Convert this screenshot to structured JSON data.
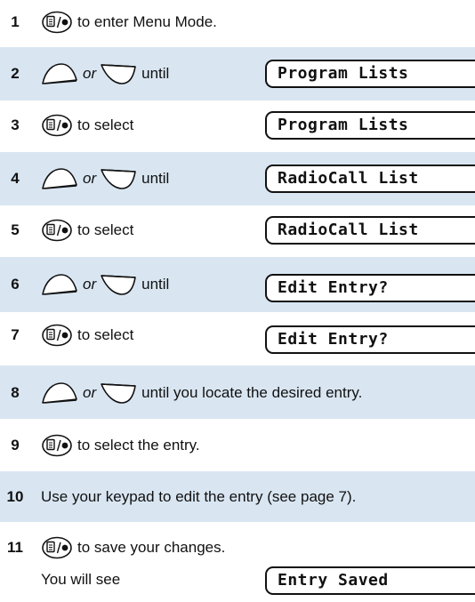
{
  "colors": {
    "shade": "#d9e6f2",
    "text": "#111111"
  },
  "icons": {
    "menu": "menu-select-button-icon",
    "up": "up-arrow-button-icon",
    "down": "down-arrow-button-icon"
  },
  "common": {
    "or": "or",
    "until": "until"
  },
  "steps": [
    {
      "num": "1",
      "text": "to enter Menu Mode."
    },
    {
      "num": "2",
      "display": "Program Lists"
    },
    {
      "num": "3",
      "text": "to select",
      "display": "Program Lists"
    },
    {
      "num": "4",
      "display": "RadioCall List"
    },
    {
      "num": "5",
      "text": "to select",
      "display": "RadioCall List"
    },
    {
      "num": "6",
      "display": "Edit Entry?"
    },
    {
      "num": "7",
      "text": "to select",
      "display": "Edit Entry?"
    },
    {
      "num": "8",
      "text": "until you locate the desired entry."
    },
    {
      "num": "9",
      "text": "to select the entry."
    },
    {
      "num": "10",
      "text": "Use your keypad to edit the entry (see page 7)."
    },
    {
      "num": "11",
      "text": "to save your changes.",
      "text2": "You will see",
      "display": "Entry Saved"
    }
  ]
}
